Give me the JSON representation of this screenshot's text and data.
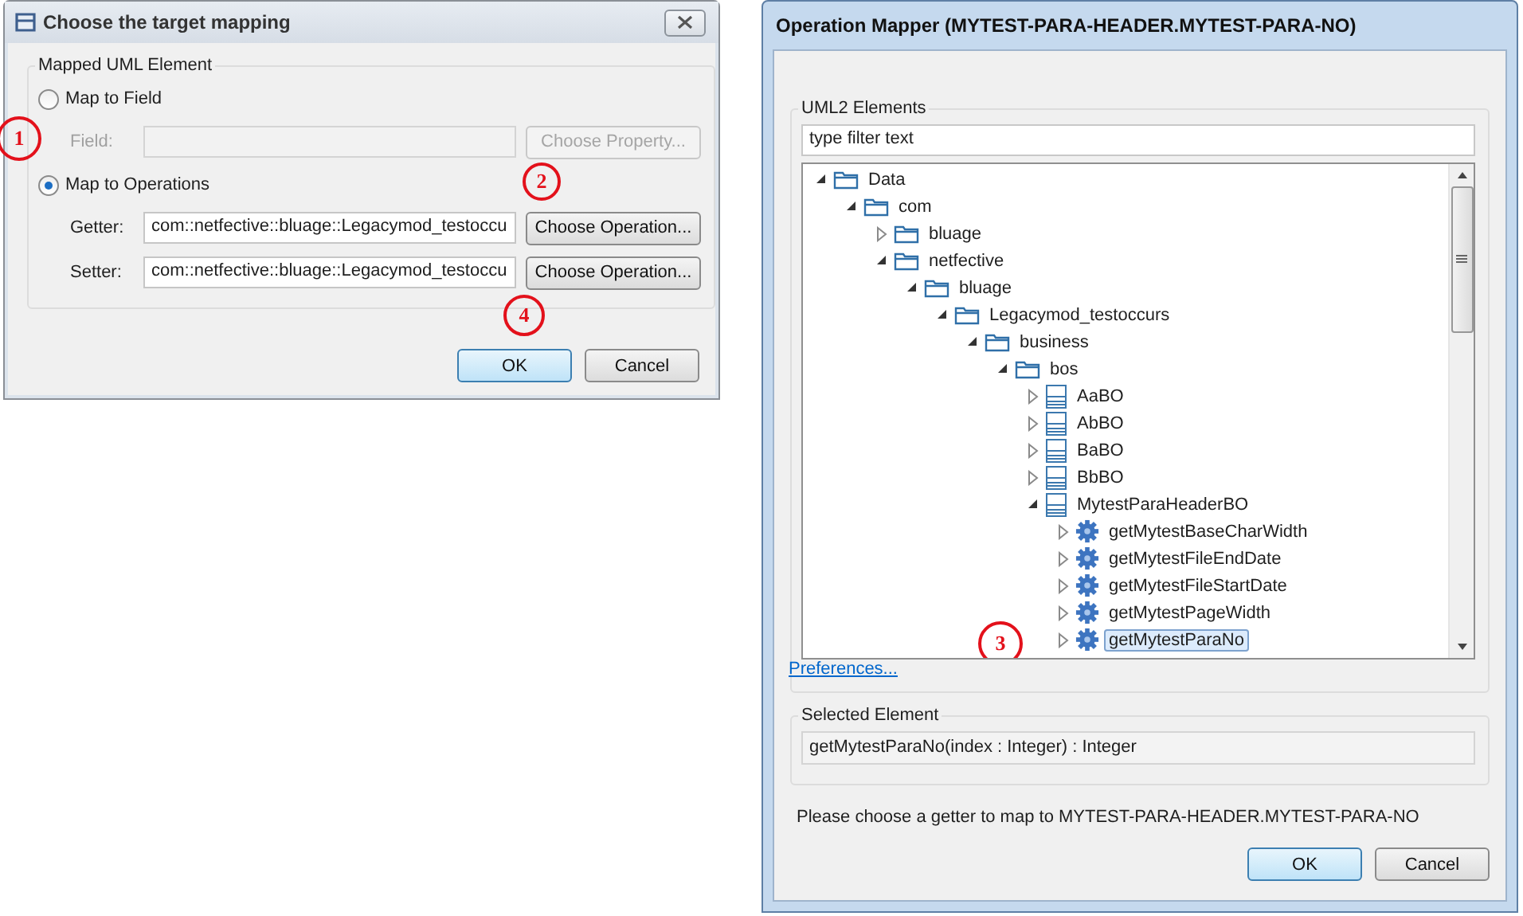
{
  "mapping_dialog": {
    "title": "Choose the target mapping",
    "group_title": "Mapped UML Element",
    "sections": [
      {
        "radio": {
          "label": "Map to Field",
          "selected": false
        },
        "rows": [
          {
            "label": "Field:",
            "button": "Choose Property...",
            "disabled": true
          }
        ]
      },
      {
        "radio": {
          "label": "Map to Operations",
          "selected": true,
          "callout": "1"
        },
        "rows": [
          {
            "label": "Getter:",
            "value": "com::netfective::bluage::Legacymod_testoccu",
            "button": "Choose Operation...",
            "disabled": false,
            "callout": "2"
          },
          {
            "label": "Setter:",
            "value": "com::netfective::bluage::Legacymod_testoccu",
            "button": "Choose Operation...",
            "disabled": false,
            "callout": "4"
          }
        ]
      }
    ],
    "buttons": [
      {
        "label": "OK",
        "default": true
      },
      {
        "label": "Cancel",
        "default": false
      }
    ]
  },
  "mapper_dialog": {
    "title": "Operation Mapper (MYTEST-PARA-HEADER.MYTEST-PARA-NO)",
    "group_title": "UML2 Elements",
    "filter": {
      "value": "type filter text"
    },
    "tree": [
      {
        "label": "Data",
        "kind": "folder",
        "expanded": true,
        "selected": false,
        "children": [
          {
            "label": "com",
            "kind": "folder",
            "expanded": true,
            "selected": false,
            "children": [
              {
                "label": "bluage",
                "kind": "folder",
                "expanded": false,
                "selected": false
              },
              {
                "label": "netfective",
                "kind": "folder",
                "expanded": true,
                "selected": false,
                "children": [
                  {
                    "label": "bluage",
                    "kind": "folder",
                    "expanded": true,
                    "selected": false,
                    "children": [
                      {
                        "label": "Legacymod_testoccurs",
                        "kind": "folder",
                        "expanded": true,
                        "selected": false,
                        "children": [
                          {
                            "label": "business",
                            "kind": "folder",
                            "expanded": true,
                            "selected": false,
                            "children": [
                              {
                                "label": "bos",
                                "kind": "folder",
                                "expanded": true,
                                "selected": false,
                                "children": [
                                  {
                                    "label": "AaBO",
                                    "kind": "class",
                                    "expanded": false,
                                    "selected": false
                                  },
                                  {
                                    "label": "AbBO",
                                    "kind": "class",
                                    "expanded": false,
                                    "selected": false
                                  },
                                  {
                                    "label": "BaBO",
                                    "kind": "class",
                                    "expanded": false,
                                    "selected": false
                                  },
                                  {
                                    "label": "BbBO",
                                    "kind": "class",
                                    "expanded": false,
                                    "selected": false
                                  },
                                  {
                                    "label": "MytestParaHeaderBO",
                                    "kind": "class",
                                    "expanded": true,
                                    "selected": false,
                                    "children": [
                                      {
                                        "label": "getMytestBaseCharWidth",
                                        "kind": "operation",
                                        "expanded": false,
                                        "selected": false
                                      },
                                      {
                                        "label": "getMytestFileEndDate",
                                        "kind": "operation",
                                        "expanded": false,
                                        "selected": false
                                      },
                                      {
                                        "label": "getMytestFileStartDate",
                                        "kind": "operation",
                                        "expanded": false,
                                        "selected": false
                                      },
                                      {
                                        "label": "getMytestPageWidth",
                                        "kind": "operation",
                                        "expanded": false,
                                        "selected": false
                                      },
                                      {
                                        "label": "getMytestParaNo",
                                        "kind": "operation",
                                        "expanded": false,
                                        "selected": true,
                                        "callout": "3"
                                      }
                                    ]
                                  }
                                ]
                              }
                            ]
                          }
                        ]
                      }
                    ]
                  }
                ]
              }
            ]
          }
        ]
      }
    ],
    "link": "Preferences...",
    "selected_group_title": "Selected Element",
    "selected_value": "getMytestParaNo(index : Integer) : Integer",
    "message": "Please choose a getter to map to MYTEST-PARA-HEADER.MYTEST-PARA-NO",
    "buttons": [
      {
        "label": "OK",
        "default": true
      },
      {
        "label": "Cancel",
        "default": false
      }
    ]
  }
}
